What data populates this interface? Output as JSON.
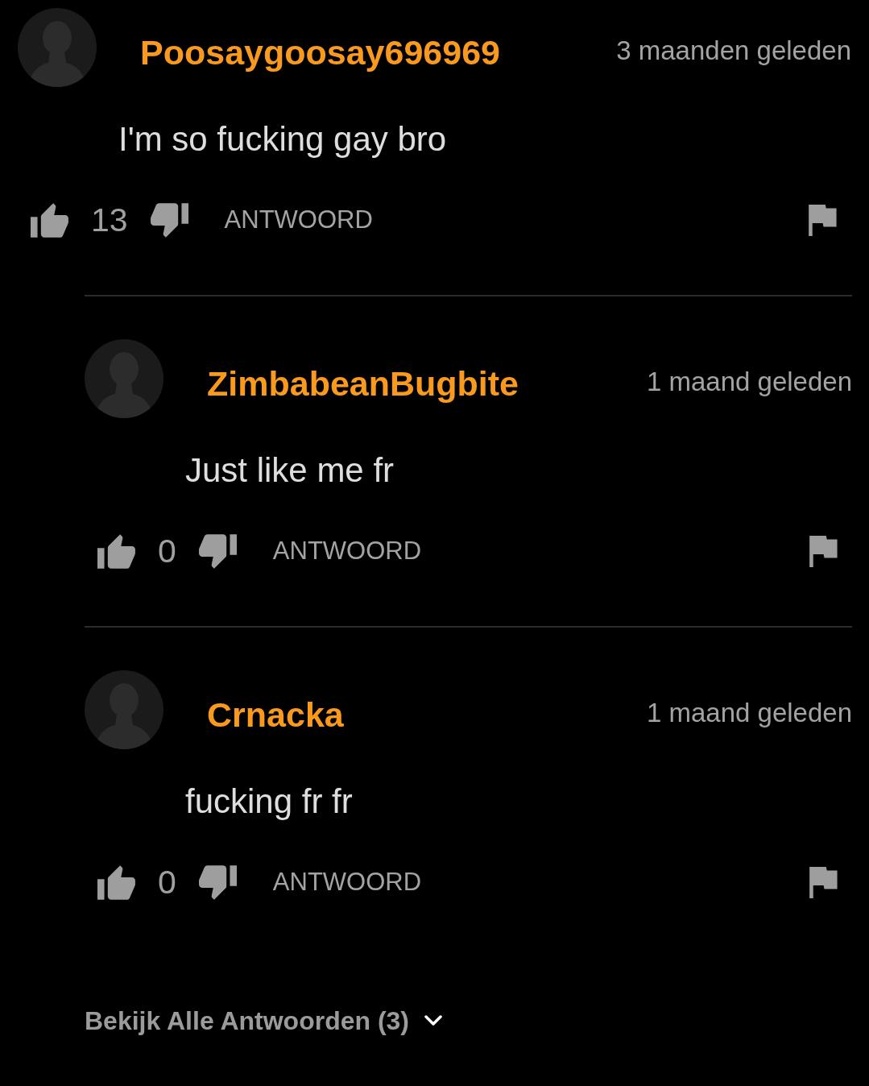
{
  "comment": {
    "username": "Poosaygoosay696969",
    "time": "3 maanden geleden",
    "text": "I'm so fucking gay bro",
    "likes": "13",
    "reply_label": "ANTWOORD",
    "replies": [
      {
        "username": "ZimbabeanBugbite",
        "time": "1 maand geleden",
        "text": "Just like me fr",
        "likes": "0",
        "reply_label": "ANTWOORD"
      },
      {
        "username": "Crnacka",
        "time": "1 maand geleden",
        "text": "fucking fr fr",
        "likes": "0",
        "reply_label": "ANTWOORD"
      }
    ]
  },
  "view_all_replies": "Bekijk Alle Antwoorden (3)"
}
